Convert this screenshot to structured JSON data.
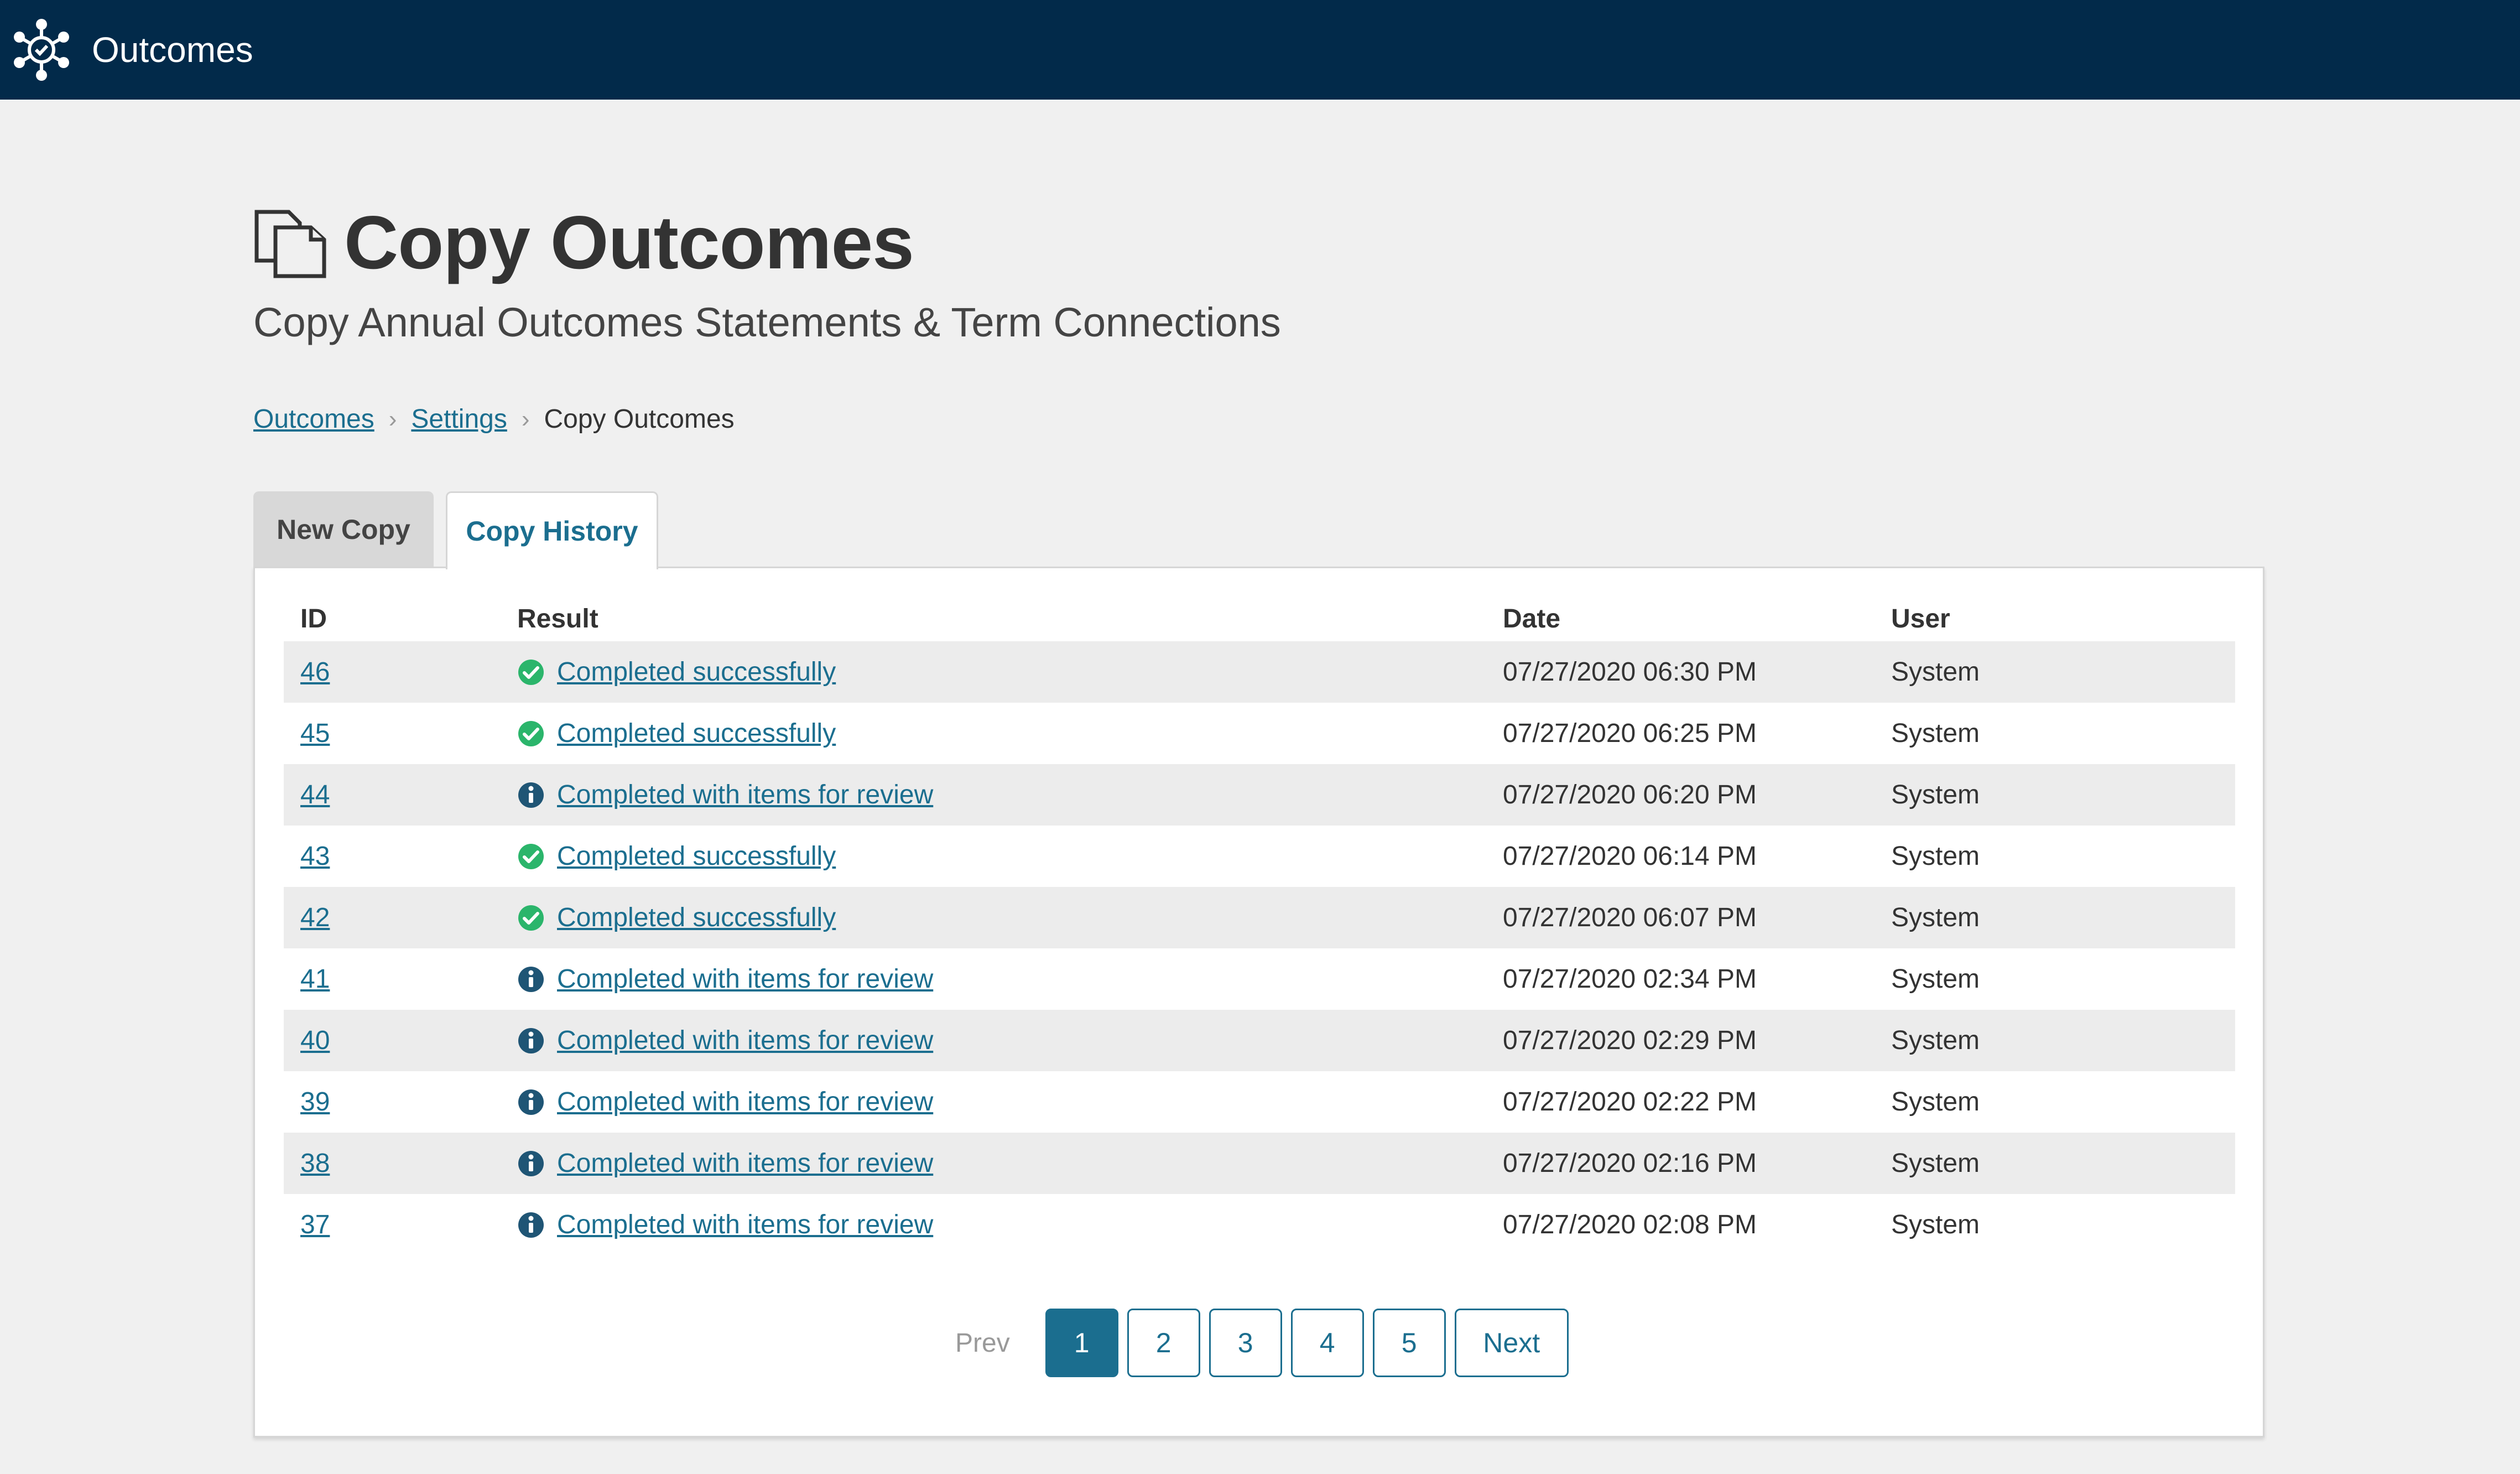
{
  "colors": {
    "header_bg": "#022a4a",
    "link": "#1b6e8f",
    "success": "#2bb56b",
    "info": "#1f5575"
  },
  "header": {
    "logo_icon": "network-hub-icon",
    "app_name": "Outcomes"
  },
  "page": {
    "icon": "copy-documents-icon",
    "title": "Copy Outcomes",
    "subtitle": "Copy Annual Outcomes Statements & Term Connections"
  },
  "breadcrumb": {
    "items": [
      "Outcomes",
      "Settings"
    ],
    "current": "Copy Outcomes"
  },
  "tabs": [
    {
      "label": "New Copy",
      "active": false
    },
    {
      "label": "Copy History",
      "active": true
    }
  ],
  "table": {
    "headers": [
      "ID",
      "Result",
      "Date",
      "User"
    ],
    "rows": [
      {
        "id": "46",
        "status": "success",
        "result": "Completed successfully",
        "date": "07/27/2020 06:30 PM",
        "user": "System"
      },
      {
        "id": "45",
        "status": "success",
        "result": "Completed successfully",
        "date": "07/27/2020 06:25 PM",
        "user": "System"
      },
      {
        "id": "44",
        "status": "info",
        "result": "Completed with items for review",
        "date": "07/27/2020 06:20 PM",
        "user": "System"
      },
      {
        "id": "43",
        "status": "success",
        "result": "Completed successfully",
        "date": "07/27/2020 06:14 PM",
        "user": "System"
      },
      {
        "id": "42",
        "status": "success",
        "result": "Completed successfully",
        "date": "07/27/2020 06:07 PM",
        "user": "System"
      },
      {
        "id": "41",
        "status": "info",
        "result": "Completed with items for review",
        "date": "07/27/2020 02:34 PM",
        "user": "System"
      },
      {
        "id": "40",
        "status": "info",
        "result": "Completed with items for review",
        "date": "07/27/2020 02:29 PM",
        "user": "System"
      },
      {
        "id": "39",
        "status": "info",
        "result": "Completed with items for review",
        "date": "07/27/2020 02:22 PM",
        "user": "System"
      },
      {
        "id": "38",
        "status": "info",
        "result": "Completed with items for review",
        "date": "07/27/2020 02:16 PM",
        "user": "System"
      },
      {
        "id": "37",
        "status": "info",
        "result": "Completed with items for review",
        "date": "07/27/2020 02:08 PM",
        "user": "System"
      }
    ]
  },
  "pagination": {
    "prev_label": "Prev",
    "pages": [
      "1",
      "2",
      "3",
      "4",
      "5"
    ],
    "current": "1",
    "next_label": "Next"
  }
}
